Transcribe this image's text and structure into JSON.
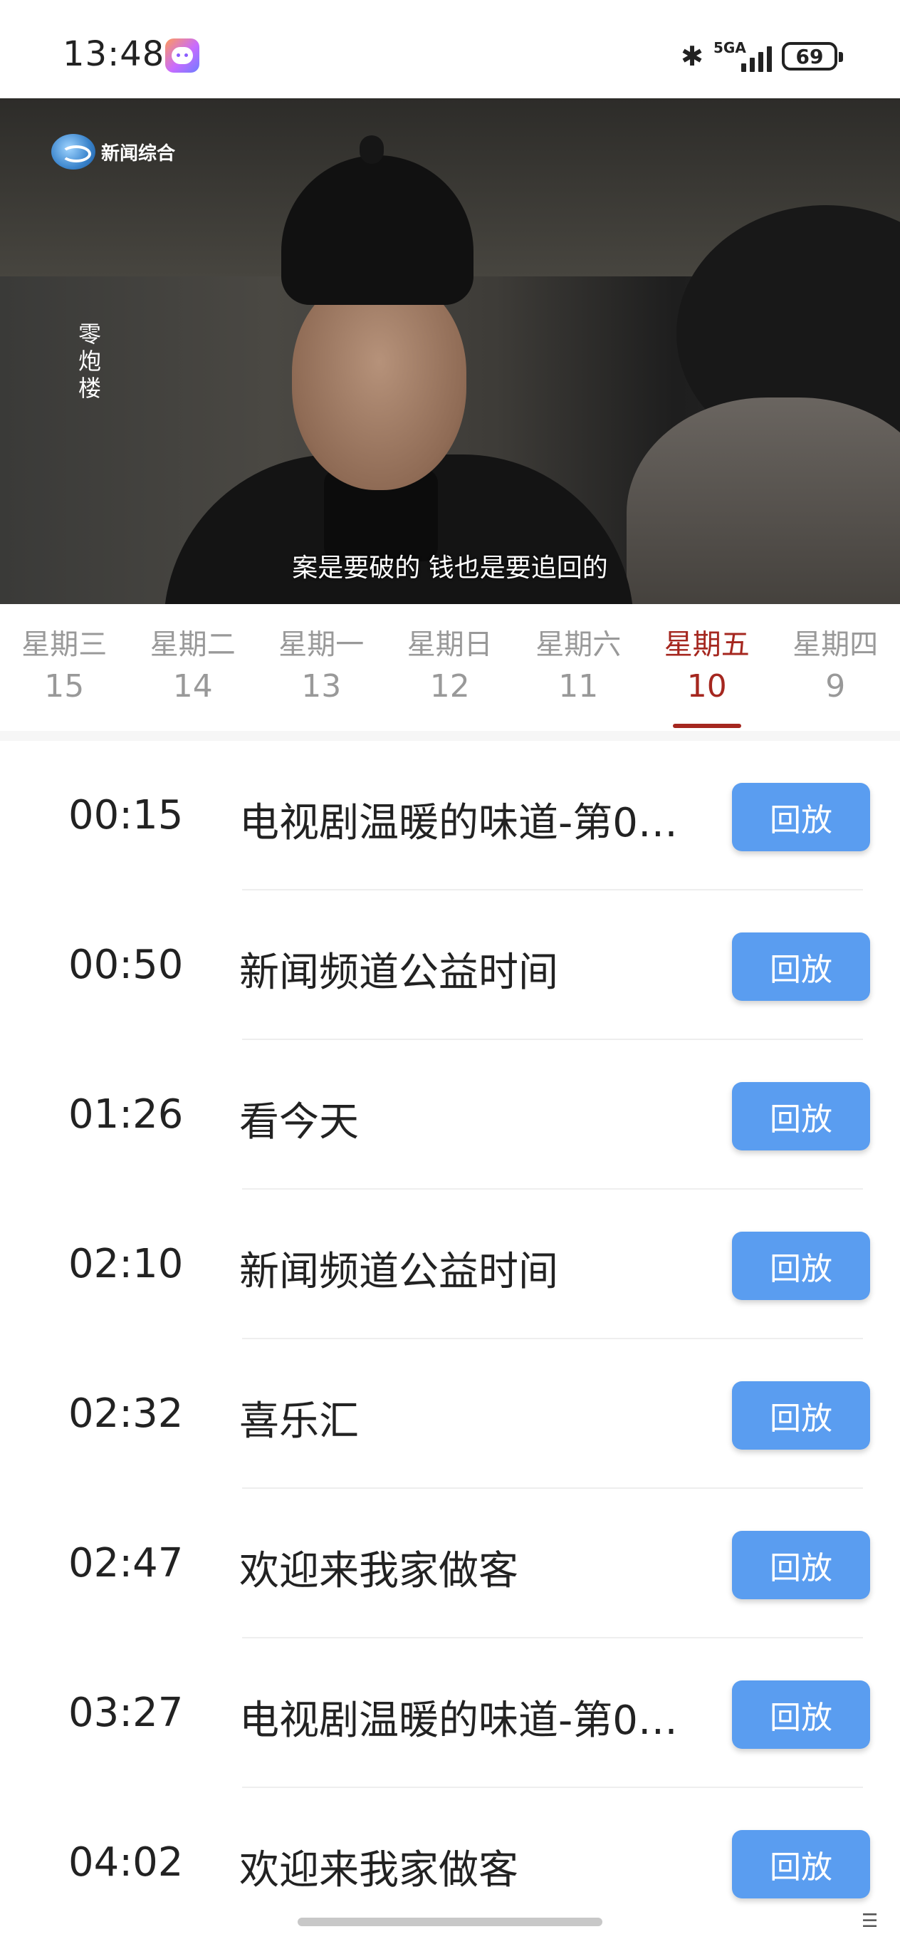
{
  "status_bar": {
    "time": "13:48",
    "network": "5GA",
    "battery": "69"
  },
  "video": {
    "channel_logo_text": "新闻综合",
    "drama_title": "零炮楼",
    "subtitle": "案是要破的 钱也是要追回的"
  },
  "day_tabs": [
    {
      "name": "星期三",
      "date": "15",
      "active": false
    },
    {
      "name": "星期二",
      "date": "14",
      "active": false
    },
    {
      "name": "星期一",
      "date": "13",
      "active": false
    },
    {
      "name": "星期日",
      "date": "12",
      "active": false
    },
    {
      "name": "星期六",
      "date": "11",
      "active": false
    },
    {
      "name": "星期五",
      "date": "10",
      "active": true
    },
    {
      "name": "星期四",
      "date": "9",
      "active": false
    }
  ],
  "accent_color": "#a5271f",
  "button_color": "#5a9df0",
  "programs": [
    {
      "time": "00:15",
      "title": "电视剧温暖的味道-第0…",
      "action": "回放"
    },
    {
      "time": "00:50",
      "title": "新闻频道公益时间",
      "action": "回放"
    },
    {
      "time": "01:26",
      "title": "看今天",
      "action": "回放"
    },
    {
      "time": "02:10",
      "title": "新闻频道公益时间",
      "action": "回放"
    },
    {
      "time": "02:32",
      "title": "喜乐汇",
      "action": "回放"
    },
    {
      "time": "02:47",
      "title": "欢迎来我家做客",
      "action": "回放"
    },
    {
      "time": "03:27",
      "title": "电视剧温暖的味道-第0…",
      "action": "回放"
    },
    {
      "time": "04:02",
      "title": "欢迎来我家做客",
      "action": "回放"
    }
  ]
}
